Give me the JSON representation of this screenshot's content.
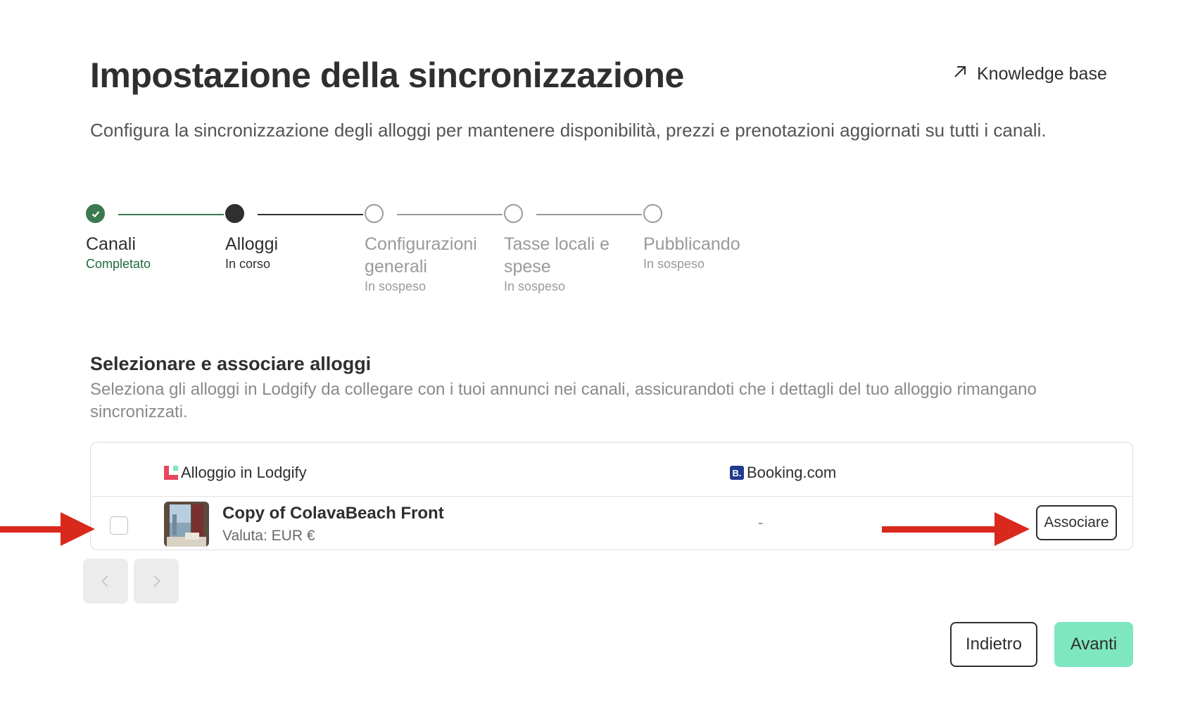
{
  "header": {
    "title": "Impostazione della sincronizzazione",
    "kb_label": "Knowledge base",
    "subtitle": "Configura la sincronizzazione degli alloggi per mantenere disponibilità, prezzi e prenotazioni aggiornati su tutti i canali."
  },
  "stepper": {
    "steps": [
      {
        "label": "Canali",
        "status": "Completato",
        "state": "done"
      },
      {
        "label": "Alloggi",
        "status": "In corso",
        "state": "current"
      },
      {
        "label": "Configurazioni generali",
        "status": "In sospeso",
        "state": "pending"
      },
      {
        "label": "Tasse locali e spese",
        "status": "In sospeso",
        "state": "pending"
      },
      {
        "label": "Pubblicando",
        "status": "In sospeso",
        "state": "pending"
      }
    ]
  },
  "section": {
    "title": "Selezionare e associare alloggi",
    "description": "Seleziona gli alloggi in Lodgify da collegare con i tuoi annunci nei canali, assicurandoti che i dettagli del tuo alloggio rimangano sincronizzati."
  },
  "table": {
    "col_lodgify": "Alloggio in Lodgify",
    "col_booking": "Booking.com",
    "booking_logo_text": "B.",
    "rows": [
      {
        "name": "Copy of ColavaBeach Front",
        "currency": "Valuta: EUR €",
        "booking_value": "-",
        "action_label": "Associare",
        "checked": false
      }
    ]
  },
  "footer": {
    "back_label": "Indietro",
    "next_label": "Avanti"
  },
  "colors": {
    "done_green": "#3b7a4f",
    "next_button": "#7ee7c0",
    "annotation_arrow": "#d9291c",
    "booking_blue": "#223a8f"
  },
  "icons": [
    "external-link-icon",
    "check-icon",
    "lodgify-logo-icon",
    "booking-logo-icon",
    "chevron-left-icon",
    "chevron-right-icon"
  ]
}
